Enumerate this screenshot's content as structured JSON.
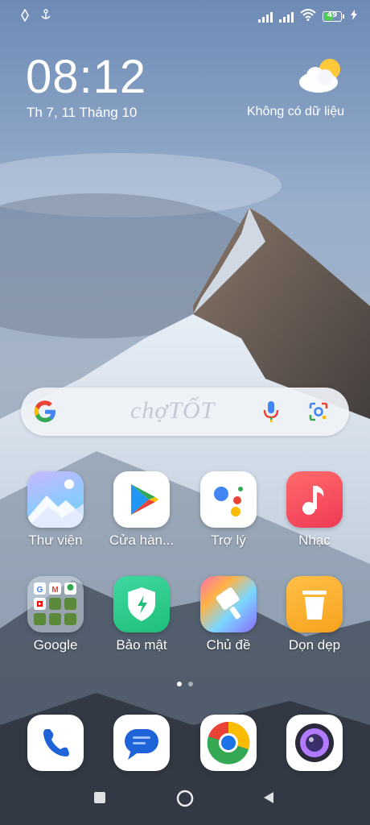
{
  "status_bar": {
    "battery_level": "49"
  },
  "lockscreen": {
    "time": "08:12",
    "date": "Th 7, 11 Tháng 10",
    "weather_text": "Không có dữ liệu"
  },
  "search_bar": {
    "watermark": "chợTỐT"
  },
  "apps_row1": [
    {
      "label": "Thư viện"
    },
    {
      "label": "Cửa hàn..."
    },
    {
      "label": "Trợ lý"
    },
    {
      "label": "Nhạc"
    }
  ],
  "apps_row2": [
    {
      "label": "Google"
    },
    {
      "label": "Bảo mật"
    },
    {
      "label": "Chủ đề"
    },
    {
      "label": "Dọn dẹp"
    }
  ],
  "colors": {
    "battery_fill": "#4dd04d",
    "music_red": "#f03a55",
    "security_green": "#1fbf7a",
    "cleaner_orange": "#f7a21e"
  }
}
